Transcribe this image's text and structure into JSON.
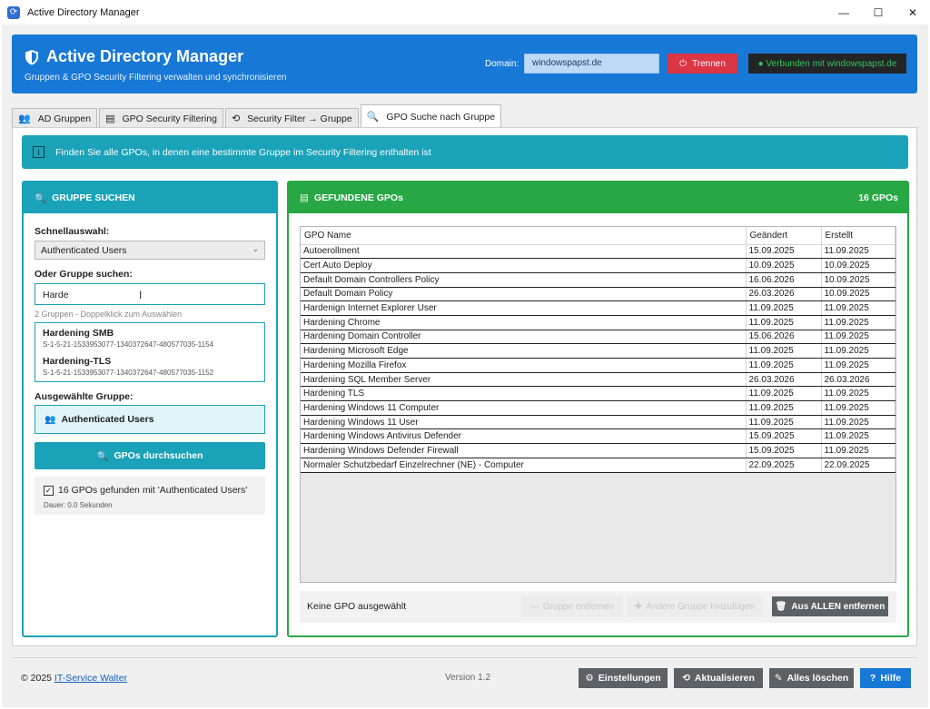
{
  "window": {
    "title": "Active Directory Manager"
  },
  "header": {
    "title": "Active Directory Manager",
    "subtitle": "Gruppen & GPO Security Filtering verwalten und synchronisieren",
    "domain_label": "Domain:",
    "domain_value": "windowspapst.de",
    "disconnect_label": "Trennen",
    "status_label": "● Verbunden mit windowspapst.de",
    "accent": "#1878d6"
  },
  "tabs": [
    {
      "label": "AD Gruppen",
      "icon": "users-icon"
    },
    {
      "label": "GPO Security Filtering",
      "icon": "clipboard-icon"
    },
    {
      "label": "Security Filter → Gruppe",
      "icon": "sync-icon"
    },
    {
      "label": "GPO Suche nach Gruppe",
      "icon": "search-icon",
      "active": true
    }
  ],
  "info": {
    "text": "Finden Sie alle GPOs, in denen eine bestimmte Gruppe im Security Filtering enthalten ist"
  },
  "left": {
    "title": "GRUPPE SUCHEN",
    "quick_label": "Schnellauswahl:",
    "quick_value": "Authenticated Users",
    "search_label": "Oder Gruppe suchen:",
    "search_value": "Harde",
    "hint": "2 Gruppen - Doppelklick zum Auswählen",
    "results": [
      {
        "name": "Hardening SMB",
        "sid": "S-1-5-21-1533953077-1340372647-480577035-1154"
      },
      {
        "name": "Hardening-TLS",
        "sid": "S-1-5-21-1533953077-1340372647-480577035-1152"
      }
    ],
    "selected_label": "Ausgewählte Gruppe:",
    "selected_value": "Authenticated Users",
    "search_button": "GPOs durchsuchen",
    "result_text": "16 GPOs gefunden mit 'Authenticated Users'",
    "duration": "Dauer: 0.0 Sekunden",
    "color": "#1aa2b8"
  },
  "right": {
    "title": "GEFUNDENE GPOs",
    "count": "16 GPOs",
    "columns": [
      "GPO Name",
      "Geändert",
      "Erstellt"
    ],
    "rows": [
      [
        "Autoerollment",
        "15.09.2025",
        "11.09.2025"
      ],
      [
        "Cert Auto Deploy",
        "10.09.2025",
        "10.09.2025"
      ],
      [
        "Default Domain Controllers Policy",
        "16.06.2026",
        "10.09.2025"
      ],
      [
        "Default Domain Policy",
        "26.03.2026",
        "10.09.2025"
      ],
      [
        "Hardenign Internet Explorer User",
        "11.09.2025",
        "11.09.2025"
      ],
      [
        "Hardening Chrome",
        "11.09.2025",
        "11.09.2025"
      ],
      [
        "Hardening Domain Controller",
        "15.06.2026",
        "11.09.2025"
      ],
      [
        "Hardening Microsoft Edge",
        "11.09.2025",
        "11.09.2025"
      ],
      [
        "Hardening Mozilla Firefox",
        "11.09.2025",
        "11.09.2025"
      ],
      [
        "Hardening SQL Member Server",
        "26.03.2026",
        "26.03.2026"
      ],
      [
        "Hardening TLS",
        "11.09.2025",
        "11.09.2025"
      ],
      [
        "Hardening Windows 11 Computer",
        "11.09.2025",
        "11.09.2025"
      ],
      [
        "Hardening Windows 11 User",
        "11.09.2025",
        "11.09.2025"
      ],
      [
        "Hardening Windows Antivirus Defender",
        "15.09.2025",
        "11.09.2025"
      ],
      [
        "Hardening Windows Defender Firewall",
        "15.09.2025",
        "11.09.2025"
      ],
      [
        "Normaler Schutzbedarf Einzelrechner (NE) - Computer",
        "22.09.2025",
        "22.09.2025"
      ]
    ],
    "no_selection": "Keine GPO ausgewählt",
    "btn_remove": "Gruppe entfernen",
    "btn_add": "Andere Gruppe hinzufügen",
    "btn_remove_all": "Aus ALLEN entfernen",
    "color": "#28a745"
  },
  "footer": {
    "copyright": "© 2025",
    "company": "IT-Service Walter",
    "version": "Version 1.2",
    "btn_settings": "Einstellungen",
    "btn_refresh": "Aktualisieren",
    "btn_clear": "Alles löschen",
    "btn_help": "Hilfe"
  }
}
